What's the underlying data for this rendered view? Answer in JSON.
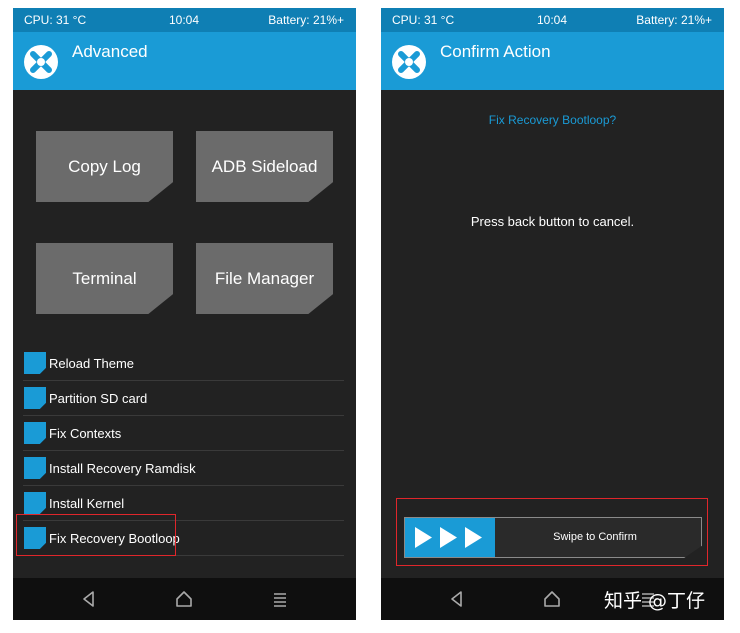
{
  "status_bar": {
    "cpu": "CPU: 31 °C",
    "time": "10:04",
    "battery": "Battery: 21%+"
  },
  "left_screen": {
    "title": "Advanced",
    "buttons": [
      "Copy Log",
      "ADB Sideload",
      "Terminal",
      "File Manager"
    ],
    "list_items": [
      "Reload Theme",
      "Partition SD card",
      "Fix Contexts",
      "Install Recovery Ramdisk",
      "Install Kernel",
      "Fix Recovery Bootloop"
    ]
  },
  "right_screen": {
    "title": "Confirm Action",
    "question": "Fix Recovery Bootloop?",
    "cancel_text": "Press back button to cancel.",
    "swipe_label": "Swipe to Confirm"
  },
  "watermark": "知乎 @丁仔",
  "colors": {
    "accent": "#1a9bd6",
    "status_bar": "#0f7fb4",
    "background": "#222222",
    "button": "#6b6b6b",
    "highlight": "#e0262b"
  },
  "icons": [
    "twrp-logo-icon",
    "back-icon",
    "home-icon",
    "menu-icon",
    "swipe-arrow-icon"
  ]
}
